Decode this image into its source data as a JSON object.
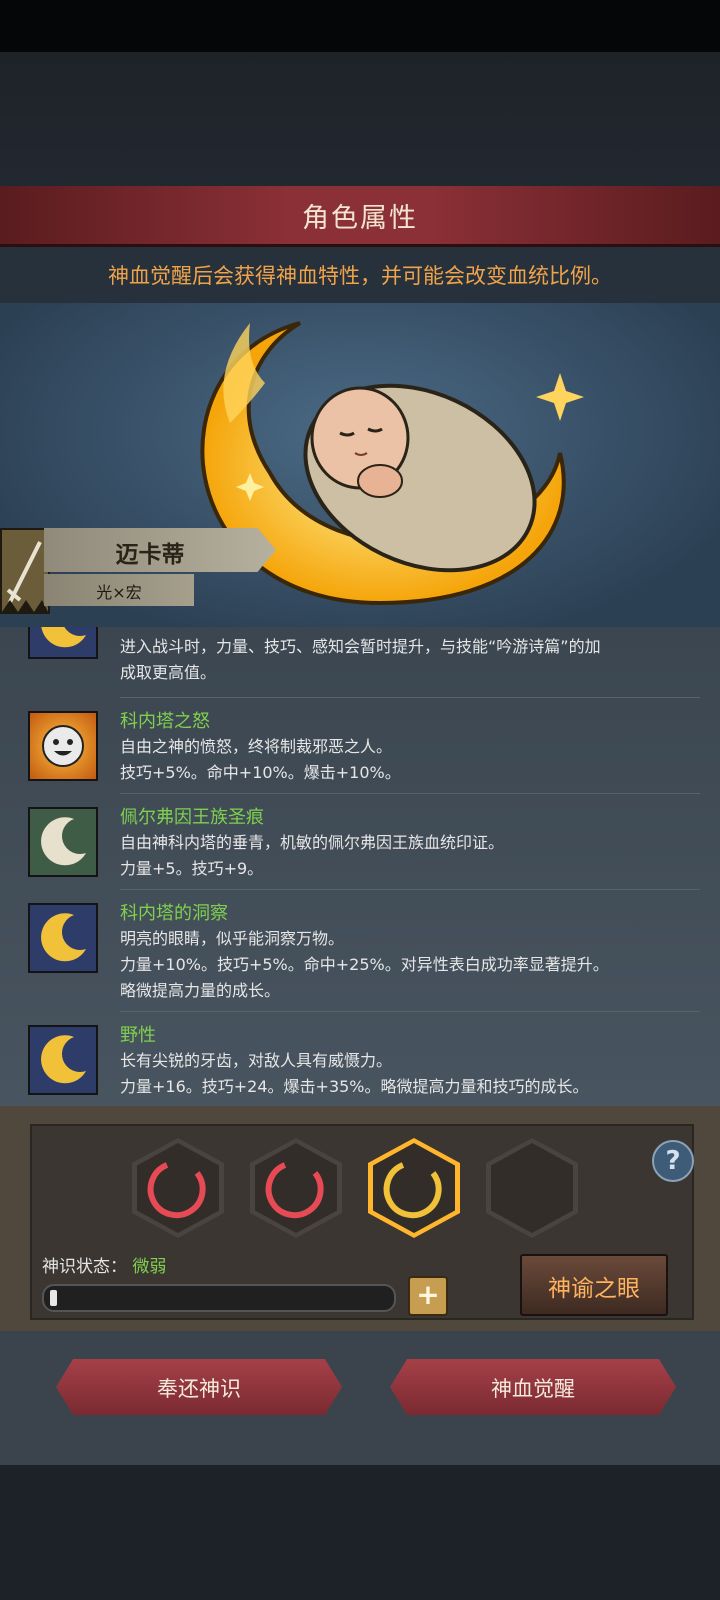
{
  "title": "角色属性",
  "notice": "神血觉醒后会获得神血特性，并可能会改变血统比例。",
  "character": {
    "name": "迈卡蒂",
    "attribute": "光×宏"
  },
  "partial_item": {
    "line1": "进入战斗时，力量、技巧、感知会暂时提升，与技能“吟游诗篇”的加",
    "line2": "成取更高值。"
  },
  "traits": [
    {
      "name": "科内塔之怒",
      "lines": [
        "自由之神的愤怒，终将制裁邪恶之人。",
        "技巧+5%。命中+10%。爆击+10%。"
      ]
    },
    {
      "name": "佩尔弗因王族圣痕",
      "lines": [
        "自由神科内塔的垂青，机敏的佩尔弗因王族血统印证。",
        "力量+5。技巧+9。"
      ]
    },
    {
      "name": "科内塔的洞察",
      "lines": [
        "明亮的眼睛，似乎能洞察万物。",
        "力量+10%。技巧+5%。命中+25%。对异性表白成功率显著提升。",
        "略微提高力量的成长。"
      ]
    },
    {
      "name": "野性",
      "lines": [
        "长有尖锐的牙齿，对敌人具有威慑力。",
        "力量+16。技巧+24。爆击+35%。略微提高力量和技巧的成长。"
      ]
    }
  ],
  "divine": {
    "status_label": "神识状态：",
    "status_value": "微弱",
    "progress": 0.02,
    "oracle_button": "神谕之眼",
    "help": "?"
  },
  "buttons": {
    "return": "奉还神识",
    "awaken": "神血觉醒"
  },
  "colors": {
    "accent_red": "#8a3036",
    "notice_orange": "#f0a34a",
    "trait_green": "#7fd04f",
    "selected_gold": "#ffb52c"
  }
}
